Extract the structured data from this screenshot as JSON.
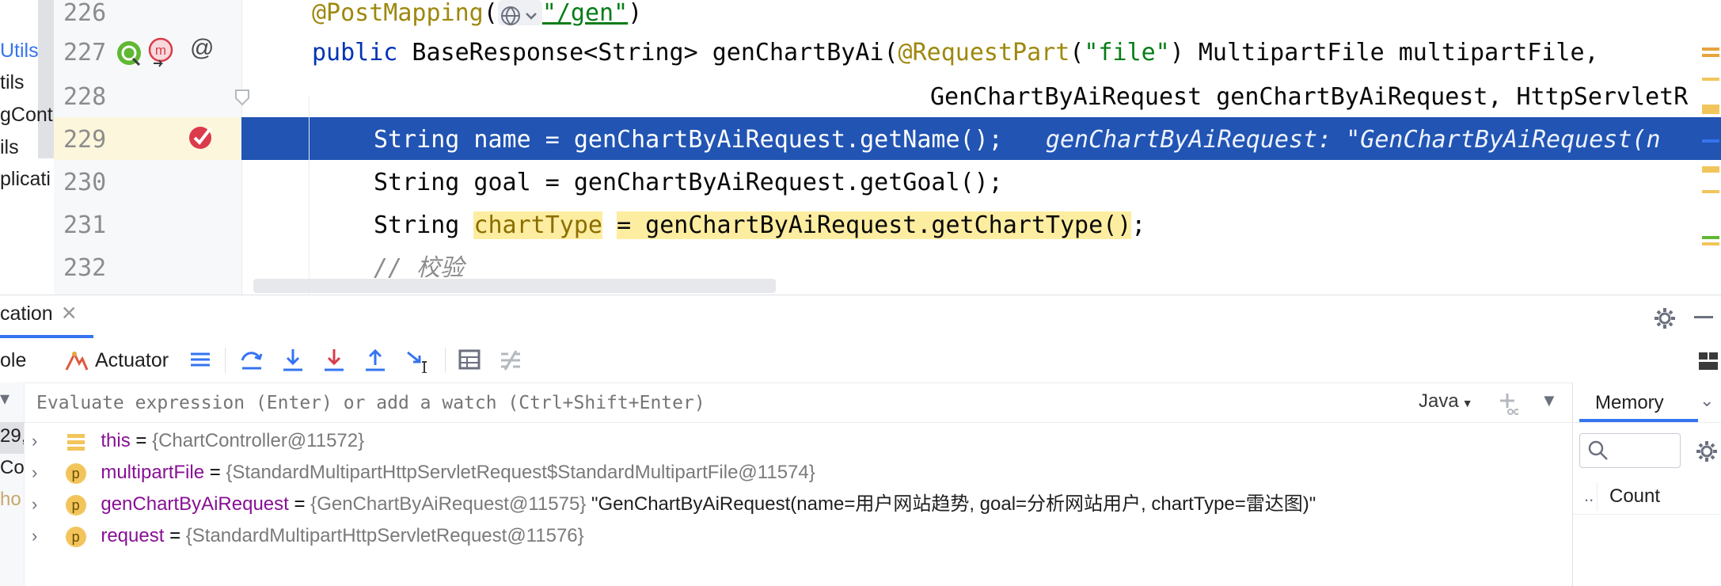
{
  "project_strip": {
    "items": [
      "Utils",
      "tils",
      "gCont",
      "ils",
      "plicati"
    ]
  },
  "editor": {
    "line_numbers": [
      "226",
      "227",
      "228",
      "229",
      "230",
      "231",
      "232"
    ],
    "lines": {
      "l226": {
        "ann": "@PostMapping",
        "paren_open": "(",
        "str": "\"/gen\"",
        "paren_close": ")"
      },
      "l227": {
        "kw": "public",
        "rest1": " BaseResponse<String> genChartByAi(",
        "ann": "@RequestPart",
        "p1": "(",
        "str": "\"file\"",
        "rest2": ") MultipartFile multipartFile,"
      },
      "l228": {
        "text": "GenChartByAiRequest genChartByAiRequest, HttpServletR"
      },
      "l229": {
        "code": "String name = genChartByAiRequest.getName();",
        "inlay": "genChartByAiRequest: \"GenChartByAiRequest(n"
      },
      "l230": {
        "code": "String goal = genChartByAiRequest.getGoal();"
      },
      "l231": {
        "pre": "String ",
        "var": "chartType",
        "mid": " ",
        "rhs": "= genChartByAiRequest.getChartType()",
        "end": ";"
      },
      "l232": {
        "comment": "// 校验"
      }
    },
    "gutter_at": "@",
    "gutter_m": "m"
  },
  "tool_window": {
    "tab_label": "cation",
    "console_label": "ole",
    "actuator_label": "Actuator",
    "eval_placeholder": "Evaluate expression (Enter) or add a watch (Ctrl+Shift+Enter)",
    "language": "Java",
    "memory_label": "Memory",
    "count_label": "Count",
    "memory_col_dots": "..",
    "left_frames": [
      "29,",
      "Co",
      "ho"
    ],
    "variables": [
      {
        "badge": "",
        "name": "this",
        "eq": " = ",
        "value": "{ChartController@11572}",
        "desc": ""
      },
      {
        "badge": "p",
        "name": "multipartFile",
        "eq": " = ",
        "value": "{StandardMultipartHttpServletRequest$StandardMultipartFile@11574}",
        "desc": ""
      },
      {
        "badge": "p",
        "name": "genChartByAiRequest",
        "eq": " = ",
        "value": "{GenChartByAiRequest@11575}",
        "desc": " \"GenChartByAiRequest(name=用户网站趋势, goal=分析网站用户, chartType=雷达图)\""
      },
      {
        "badge": "p",
        "name": "request",
        "eq": " = ",
        "value": "{StandardMultipartHttpServletRequest@11576}",
        "desc": ""
      }
    ]
  },
  "colors": {
    "selection": "#2154b3",
    "accent": "#3574f0",
    "breakpoint": "#db3b4b",
    "highlight": "#fdeda1"
  }
}
